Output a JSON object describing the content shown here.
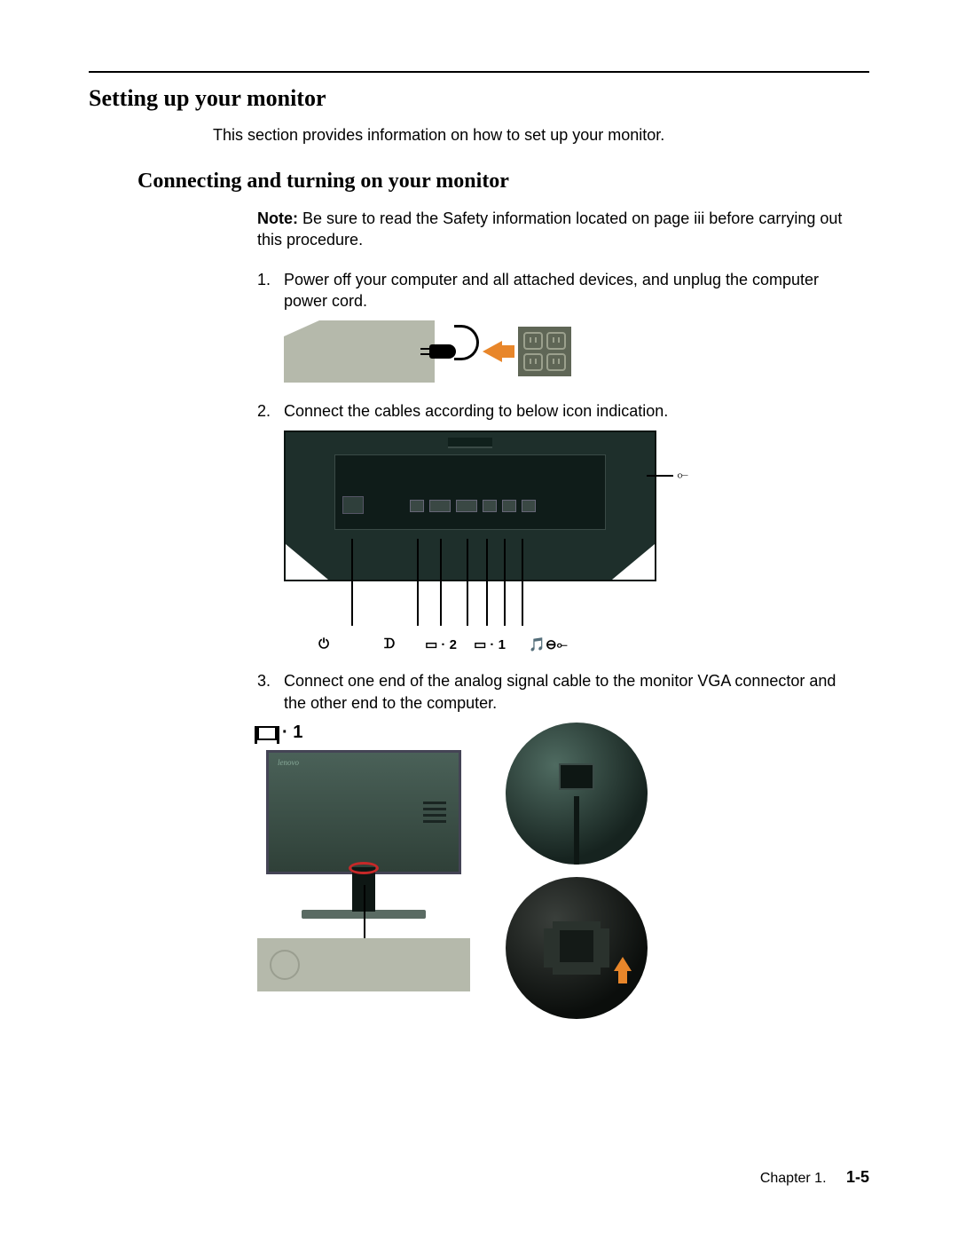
{
  "section_title": "Setting up your monitor",
  "intro": "This section provides information on how to set up your monitor.",
  "subsection_title": "Connecting and turning on your monitor",
  "note": {
    "label": "Note:",
    "text": " Be sure to read the Safety information located on page iii before carrying out this procedure."
  },
  "steps": [
    {
      "num": "1.",
      "text": "Power off your computer and all attached devices, and unplug the computer power cord."
    },
    {
      "num": "2.",
      "text": "Connect the cables according to below icon indication."
    },
    {
      "num": "3.",
      "text": "Connect one end of the analog signal cable to the monitor VGA connector and the other end to the computer."
    }
  ],
  "figure3_label": "· 1",
  "port_icons": {
    "power": "⏻",
    "dp": "ᗪ",
    "hdmi": "▭ · 2",
    "vga": "▭ · 1",
    "audio_usb": "🎵⊖⟜"
  },
  "usb_symbol": "⟜",
  "monitor_logo": "lenovo",
  "footer": {
    "chapter": "Chapter 1.",
    "page": "1-5"
  }
}
